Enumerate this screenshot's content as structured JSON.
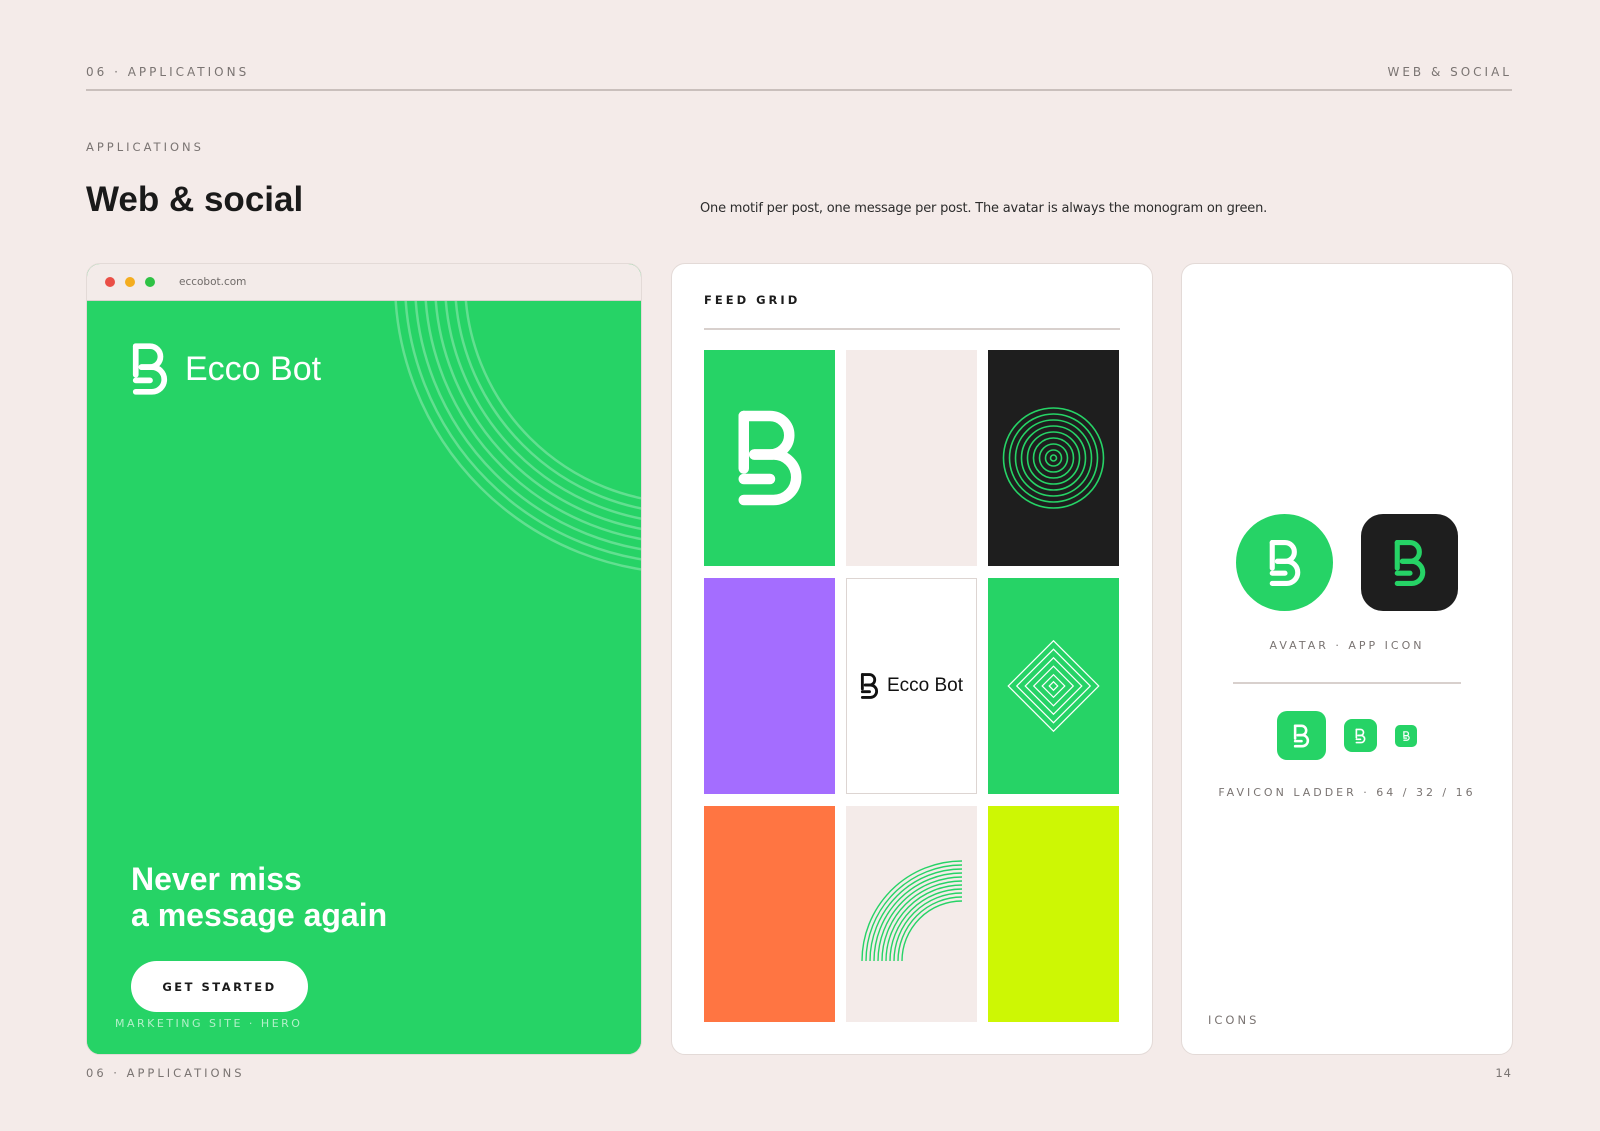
{
  "header": {
    "left": "06 · APPLICATIONS",
    "right": "WEB & SOCIAL"
  },
  "section": {
    "eyebrow": "APPLICATIONS",
    "title": "Web & social",
    "subtitle": "One motif per post, one message per post. The avatar is always the monogram on green."
  },
  "browser": {
    "url": "eccobot.com",
    "dots": [
      "#ea4f47",
      "#f4ad1f",
      "#2ec245"
    ],
    "brand_name": "Ecco Bot",
    "headline_line1": "Never miss",
    "headline_line2": "a message again",
    "cta_label": "GET STARTED",
    "caption": "MARKETING SITE · HERO"
  },
  "feed": {
    "title": "FEED GRID",
    "brand_name": "Ecco Bot"
  },
  "icons": {
    "avatar_label": "AVATAR · APP ICON",
    "favicon_label": "FAVICON LADDER · 64 / 32 / 16",
    "caption": "ICONS"
  },
  "colors": {
    "green": "#26d366",
    "beige": "#f4ebe9",
    "dark": "#1e1e1e",
    "purple": "#a46dff",
    "orange": "#ff7542",
    "lime": "#cdf704"
  },
  "footer": {
    "left": "06 · APPLICATIONS",
    "page": "14"
  }
}
